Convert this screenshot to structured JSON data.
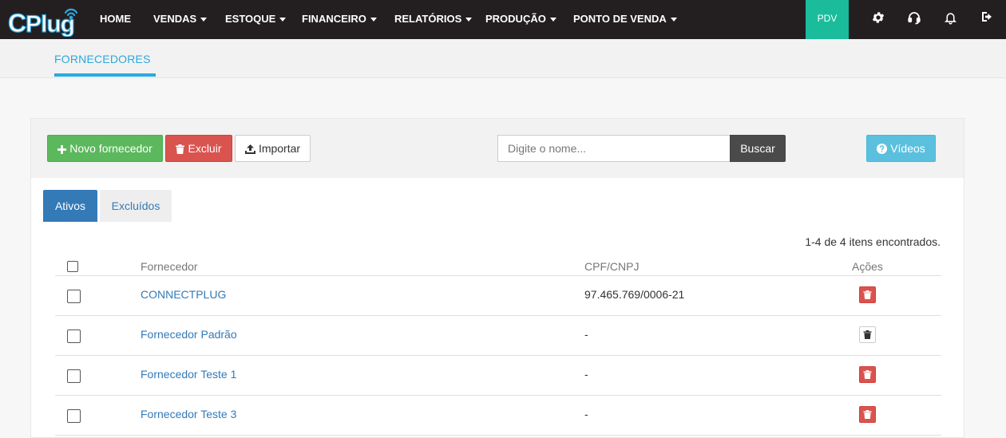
{
  "logo": {
    "text_a": "C",
    "text_b": "Plug"
  },
  "nav": {
    "items": [
      {
        "label": "HOME",
        "has_caret": false
      },
      {
        "label": "VENDAS",
        "has_caret": true
      },
      {
        "label": "ESTOQUE",
        "has_caret": true
      },
      {
        "label": "FINANCEIRO",
        "has_caret": true
      },
      {
        "label": "RELATÓRIOS",
        "has_caret": true
      },
      {
        "label": "PRODUÇÃO",
        "has_caret": true
      },
      {
        "label": "PONTO DE VENDA",
        "has_caret": true
      }
    ],
    "pdv_label": "PDV",
    "icons": [
      "gear-icon",
      "headset-icon",
      "bell-icon",
      "logout-icon"
    ]
  },
  "subheader": {
    "tab_label": "FORNECEDORES"
  },
  "toolbar": {
    "new_label": "Novo fornecedor",
    "delete_label": "Excluir",
    "import_label": "Importar",
    "search_placeholder": "Digite o nome...",
    "search_button": "Buscar",
    "videos_label": "Vídeos"
  },
  "tabs": {
    "active": "Ativos",
    "inactive": "Excluídos"
  },
  "count_text": "1-4 de 4 itens encontrados.",
  "table": {
    "headers": {
      "name": "Fornecedor",
      "doc": "CPF/CNPJ",
      "actions": "Ações"
    },
    "rows": [
      {
        "name": "CONNECTPLUG",
        "doc": "97.465.769/0006-21",
        "delete_style": "red"
      },
      {
        "name": "Fornecedor Padrão",
        "doc": "-",
        "delete_style": "white"
      },
      {
        "name": "Fornecedor Teste 1",
        "doc": "-",
        "delete_style": "red"
      },
      {
        "name": "Fornecedor Teste 3",
        "doc": "-",
        "delete_style": "red"
      }
    ]
  },
  "colors": {
    "topbar": "#231f20",
    "accent_blue": "#29a9e0",
    "pdv_green": "#1abc9c",
    "btn_green": "#5cb85c",
    "btn_red": "#d9534f",
    "btn_info": "#5bc0de",
    "link_blue": "#337ab7"
  }
}
